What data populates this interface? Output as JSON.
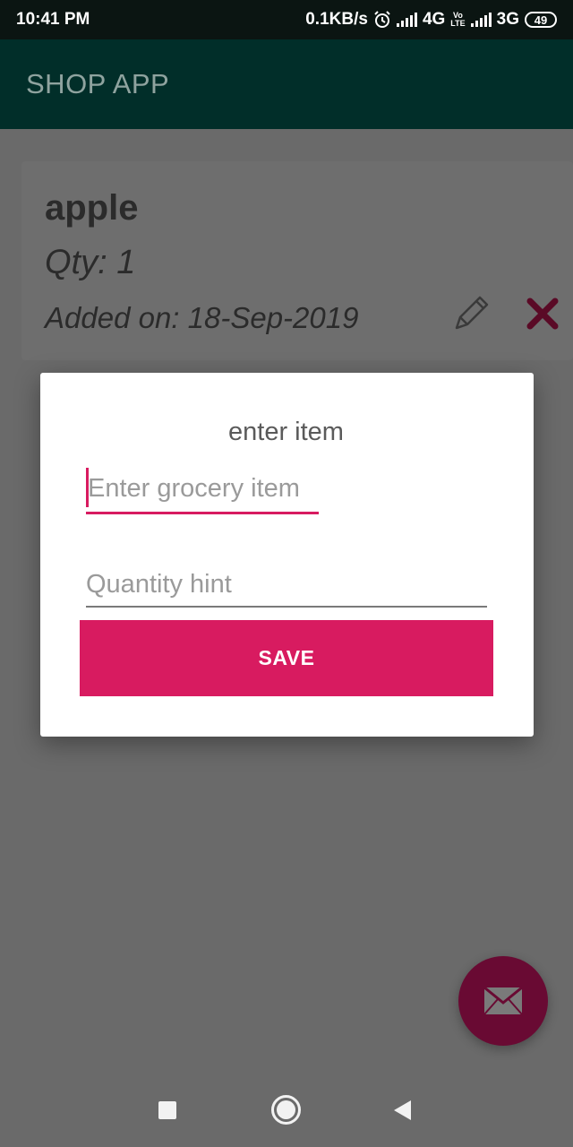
{
  "status_bar": {
    "time": "10:41 PM",
    "net_speed": "0.1KB/s",
    "network1": "4G",
    "volte_top": "Vo",
    "volte_bottom": "LTE",
    "network2": "3G",
    "battery": "49"
  },
  "app_bar": {
    "title": "SHOP APP"
  },
  "list": {
    "items": [
      {
        "name": "apple",
        "qty": "Qty: 1",
        "added": "Added on: 18-Sep-2019"
      }
    ]
  },
  "dialog": {
    "title": "enter item",
    "item_input": {
      "placeholder": "Enter grocery item",
      "value": ""
    },
    "qty_input": {
      "placeholder": "Quantity hint",
      "value": ""
    },
    "save_label": "SAVE"
  },
  "colors": {
    "accent": "#d81b60",
    "app_bar": "#012e29",
    "fab": "#690a33",
    "scrim": "#6a6a6a"
  },
  "icons": {
    "edit": "pencil-icon",
    "delete": "close-icon",
    "fab": "mail-icon",
    "nav": [
      "recents-icon",
      "home-icon",
      "back-icon"
    ]
  }
}
